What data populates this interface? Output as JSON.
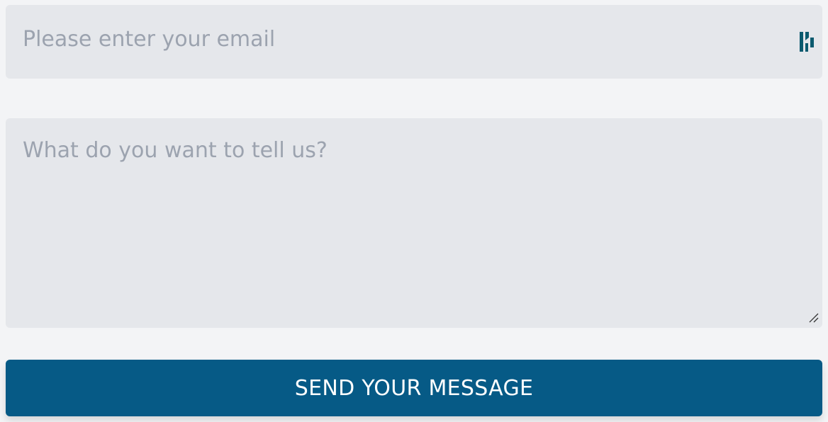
{
  "form": {
    "email": {
      "placeholder": "Please enter your email",
      "value": ""
    },
    "message": {
      "placeholder": "What do you want to tell us?",
      "value": ""
    },
    "submit_label": "SEND YOUR MESSAGE"
  },
  "icons": {
    "email_extension": "dashlane-autofill-icon",
    "textarea_resize": "resize-grip-icon"
  },
  "colors": {
    "background": "#f3f4f6",
    "field_background": "#e5e7eb",
    "placeholder": "#9ca3af",
    "button": "#065a86",
    "button_text": "#ffffff",
    "extension_icon": "#0b5a6e"
  }
}
